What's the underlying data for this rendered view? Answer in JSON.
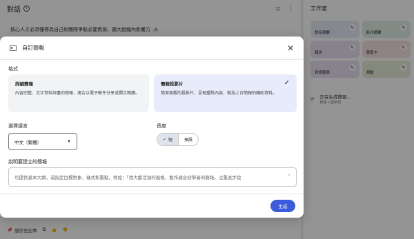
{
  "chat": {
    "title": "對話",
    "info_icon": "i",
    "message": "核心人才必須懂得為自己和團隊爭取必要資源，擴大組織內影響力",
    "citation": "4",
    "save_note": "儲存至記事",
    "filter_icon": "filter-icon",
    "more_icon": "more-vert-icon"
  },
  "studio": {
    "title": "工作室",
    "tiles": [
      {
        "label": "語音摘要",
        "color": "#e6ecf7"
      },
      {
        "label": "影片摘要",
        "color": "#dfeee4"
      },
      {
        "label": "報告",
        "color": "#e9e1f0"
      },
      {
        "label": "學習卡",
        "color": "#f5e1e1"
      },
      {
        "label": "資訊圖表",
        "color": "#e9e1f0"
      },
      {
        "label": "測驗",
        "color": "#e6ecd8"
      }
    ],
    "generating_title": "正在生成簡報...",
    "generating_sub": "根據 1 個來源"
  },
  "modal": {
    "title": "自訂簡報",
    "close_label": "✕",
    "format_label": "格式",
    "formats": [
      {
        "name": "詳細簡報",
        "desc": "內容完整、文字資料詳盡的簡報，適合以電子郵件分享或獨立閱讀。",
        "selected": false
      },
      {
        "name": "簡報投影片",
        "desc": "簡潔美觀的投影片，呈現重點內容，做為上台簡報的輔助資料。",
        "selected": true
      }
    ],
    "check_glyph": "✓",
    "language_label": "選擇語言",
    "language_value": "中文（繁體）",
    "length_label": "長度",
    "length_options": [
      {
        "label": "短",
        "active": true
      },
      {
        "label": "預設",
        "active": false
      }
    ],
    "describe_label": "說明要建立的簡報",
    "describe_placeholder": "可提供基本大綱，或指定目標對象、樣式和重點，例如：「用大膽活潑的風格，製作適合初學者的簡報，注重逐步說",
    "generate_label": "生成"
  }
}
